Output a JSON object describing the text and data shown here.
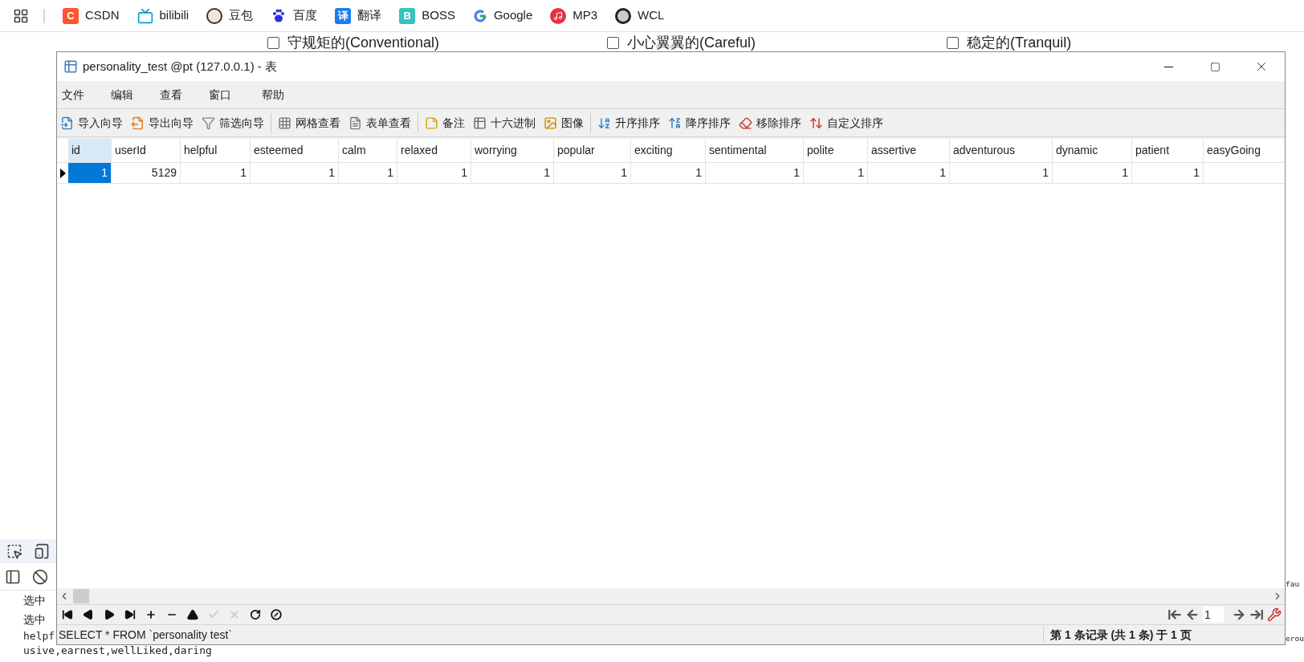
{
  "bookmarks": [
    {
      "kind": "apps"
    },
    {
      "kind": "csdn",
      "glyph": "C",
      "label": "CSDN"
    },
    {
      "kind": "bilibili",
      "label": "bilibili"
    },
    {
      "kind": "avatar",
      "label": "豆包"
    },
    {
      "kind": "paw",
      "label": "百度"
    },
    {
      "kind": "translate",
      "glyph": "译",
      "label": "翻译"
    },
    {
      "kind": "boss",
      "glyph": "B",
      "label": "BOSS"
    },
    {
      "kind": "google",
      "label": "Google"
    },
    {
      "kind": "music",
      "label": "MP3"
    },
    {
      "kind": "badge",
      "label": "WCL"
    }
  ],
  "page": {
    "options": [
      {
        "label": "守规矩的(Conventional)",
        "checked": false
      },
      {
        "label": "小心翼翼的(Careful)",
        "checked": false
      },
      {
        "label": "稳定的(Tranquil)",
        "checked": false
      }
    ],
    "console_lines": [
      "选中",
      "选中",
      "helpf",
      "usive,earnest,wellLiked,daring"
    ],
    "right_fragments": [
      "fau",
      "erou"
    ]
  },
  "window": {
    "title": "personality_test @pt (127.0.0.1) - 表",
    "menu": [
      "文件",
      "编辑",
      "查看",
      "窗口",
      "帮助"
    ],
    "toolbar": [
      [
        {
          "kind": "import",
          "label": "导入向导"
        },
        {
          "kind": "export",
          "label": "导出向导"
        },
        {
          "kind": "filter",
          "label": "筛选向导"
        }
      ],
      [
        {
          "kind": "grid",
          "label": "网格查看"
        },
        {
          "kind": "form",
          "label": "表单查看"
        }
      ],
      [
        {
          "kind": "note",
          "label": "备注"
        },
        {
          "kind": "hex",
          "label": "十六进制"
        },
        {
          "kind": "image",
          "label": "图像"
        }
      ],
      [
        {
          "kind": "asc",
          "label": "升序排序"
        },
        {
          "kind": "desc",
          "label": "降序排序"
        },
        {
          "kind": "remove",
          "label": "移除排序"
        },
        {
          "kind": "custom",
          "label": "自定义排序"
        }
      ]
    ],
    "table": {
      "columns": [
        {
          "label": "id",
          "selected": true
        },
        {
          "label": "userId",
          "selected": false
        },
        {
          "label": "helpful",
          "selected": false
        },
        {
          "label": "esteemed",
          "selected": false
        },
        {
          "label": "calm",
          "selected": false
        },
        {
          "label": "relaxed",
          "selected": false
        },
        {
          "label": "worrying",
          "selected": false
        },
        {
          "label": "popular",
          "selected": false
        },
        {
          "label": "exciting",
          "selected": false
        },
        {
          "label": "sentimental",
          "selected": false
        },
        {
          "label": "polite",
          "selected": false
        },
        {
          "label": "assertive",
          "selected": false
        },
        {
          "label": "adventurous",
          "selected": false
        },
        {
          "label": "dynamic",
          "selected": false
        },
        {
          "label": "patient",
          "selected": false
        },
        {
          "label": "easyGoing",
          "selected": false
        }
      ],
      "rows": [
        {
          "current": true,
          "cells": [
            {
              "value": "1",
              "selected": true
            },
            {
              "value": "5129",
              "selected": false
            },
            {
              "value": "1",
              "selected": false
            },
            {
              "value": "1",
              "selected": false
            },
            {
              "value": "1",
              "selected": false
            },
            {
              "value": "1",
              "selected": false
            },
            {
              "value": "1",
              "selected": false
            },
            {
              "value": "1",
              "selected": false
            },
            {
              "value": "1",
              "selected": false
            },
            {
              "value": "1",
              "selected": false
            },
            {
              "value": "1",
              "selected": false
            },
            {
              "value": "1",
              "selected": false
            },
            {
              "value": "1",
              "selected": false
            },
            {
              "value": "1",
              "selected": false
            },
            {
              "value": "1",
              "selected": false
            }
          ]
        }
      ]
    },
    "nav": [
      {
        "kind": "first",
        "disabled": false
      },
      {
        "kind": "prev",
        "disabled": false
      },
      {
        "kind": "next",
        "disabled": false
      },
      {
        "kind": "last",
        "disabled": false
      },
      {
        "kind": "add",
        "disabled": false
      },
      {
        "kind": "delete",
        "disabled": false
      },
      {
        "kind": "up",
        "disabled": false
      },
      {
        "kind": "apply",
        "disabled": true
      },
      {
        "kind": "cancel",
        "disabled": true
      },
      {
        "kind": "refresh",
        "disabled": false
      },
      {
        "kind": "stop",
        "disabled": false
      }
    ],
    "pager": {
      "page": "1"
    },
    "status": {
      "query": "SELECT * FROM `personality test`",
      "record": "第 1 条记录 (共 1 条) 于 1 页"
    }
  }
}
